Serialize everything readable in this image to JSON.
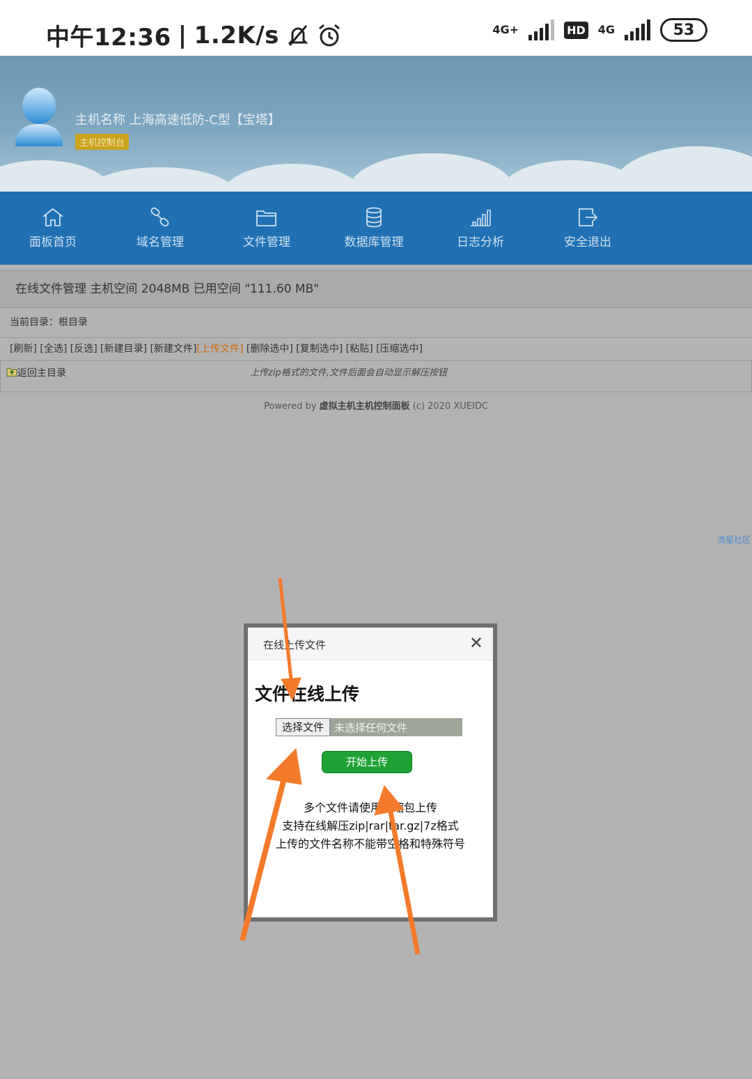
{
  "status_bar": {
    "time": "中午12:36",
    "separator": "|",
    "speed": "1.2K/s",
    "net1": "4G+",
    "hd": "HD",
    "net2": "4G",
    "battery": "53"
  },
  "header": {
    "host_name": "主机名称 上海高速低防-C型【宝塔】",
    "console_badge": "主机控制台"
  },
  "nav": {
    "items": [
      {
        "label": "面板首页",
        "icon": "home-icon"
      },
      {
        "label": "域名管理",
        "icon": "link-icon"
      },
      {
        "label": "文件管理",
        "icon": "folder-icon"
      },
      {
        "label": "数据库管理",
        "icon": "database-icon"
      },
      {
        "label": "日志分析",
        "icon": "bar-chart-icon"
      },
      {
        "label": "安全退出",
        "icon": "logout-icon"
      }
    ]
  },
  "content": {
    "title": "在线文件管理 主机空间 2048MB 已用空间 \"111.60 MB\"",
    "current_dir": "当前目录：根目录",
    "toolbar": [
      "[刷新]",
      "[全选]",
      "[反选]",
      "[新建目录]",
      "[新建文件]",
      "[上传文件]",
      "[删除选中]",
      "[复制选中]",
      "[粘贴]",
      "[压缩选中]"
    ],
    "back": "返回主目录",
    "hint": "上传zip格式的文件,文件后面会自动显示解压按钮"
  },
  "footer": {
    "prefix": "Powered by ",
    "brand": "虚拟主机主机控制面板",
    "suffix": " (c) 2020 XUEIDC"
  },
  "side_link": "流星社区",
  "modal": {
    "title": "在线上传文件",
    "heading": "文件在线上传",
    "choose_file": "选择文件",
    "no_file": "未选择任何文件",
    "upload": "开始上传",
    "notes": [
      "多个文件请使用压缩包上传",
      "支持在线解压zip|rar|tar.gz|7z格式",
      "上传的文件名称不能带空格和特殊符号"
    ]
  },
  "colors": {
    "nav_bg": "#2170b3",
    "upload_btn": "#1fa234",
    "annotation_arrow": "#f47a2b",
    "active_link": "#c86a10"
  }
}
